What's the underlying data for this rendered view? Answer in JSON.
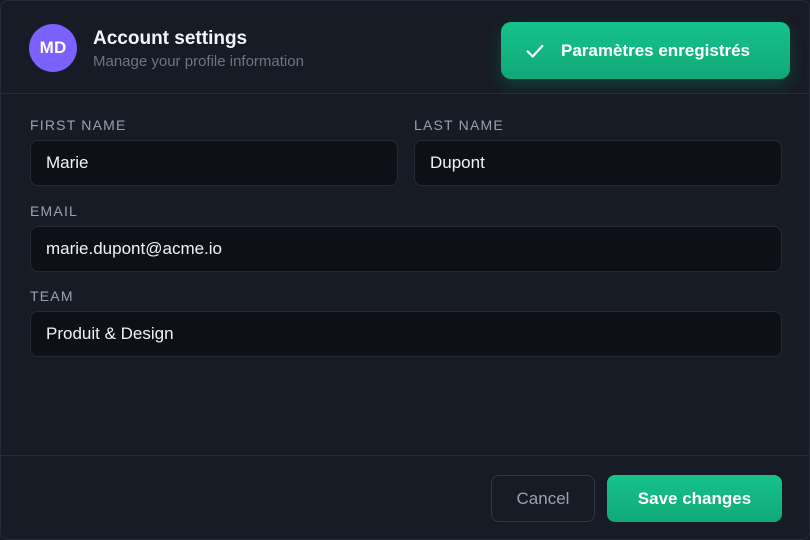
{
  "header": {
    "avatar_initials": "MD",
    "title": "Account settings",
    "subtitle": "Manage your profile information"
  },
  "toast": {
    "icon": "checkmark-icon",
    "message": "Paramètres enregistrés",
    "color": "#16c38a"
  },
  "form": {
    "first_name": {
      "label": "FIRST NAME",
      "value": "Marie"
    },
    "last_name": {
      "label": "LAST NAME",
      "value": "Dupont"
    },
    "email": {
      "label": "EMAIL",
      "value": "marie.dupont@acme.io"
    },
    "team": {
      "label": "TEAM",
      "value": "Produit & Design"
    }
  },
  "footer": {
    "cancel_label": "Cancel",
    "save_label": "Save changes"
  },
  "colors": {
    "accent": "#10b981",
    "avatar": "#7b61ff",
    "background": "#161b25"
  }
}
